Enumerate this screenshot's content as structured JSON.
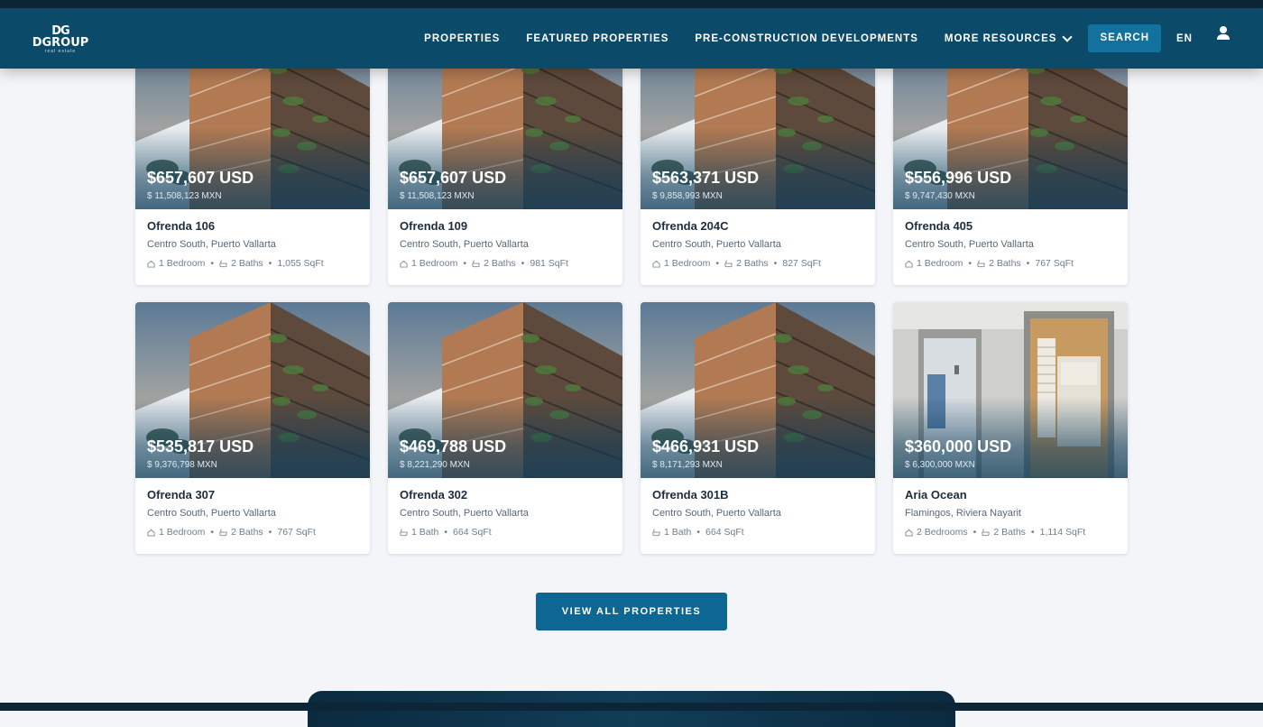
{
  "header": {
    "logo_mark": "DG",
    "logo_word": "DGROUP",
    "logo_sub": "real estate",
    "nav": [
      {
        "label": "PROPERTIES"
      },
      {
        "label": "FEATURED PROPERTIES"
      },
      {
        "label": "PRE-CONSTRUCTION DEVELOPMENTS"
      },
      {
        "label": "MORE RESOURCES"
      }
    ],
    "search_label": "SEARCH",
    "language": "EN"
  },
  "listings": [
    {
      "price_usd": "$657,607 USD",
      "price_mxn": "$ 11,508,123 MXN",
      "name": "Ofrenda 106",
      "location": "Centro South, Puerto Vallarta",
      "bedrooms": "1 Bedroom",
      "baths": "2 Baths",
      "area": "1,055 SqFt",
      "image": "building"
    },
    {
      "price_usd": "$657,607 USD",
      "price_mxn": "$ 11,508,123 MXN",
      "name": "Ofrenda 109",
      "location": "Centro South, Puerto Vallarta",
      "bedrooms": "1 Bedroom",
      "baths": "2 Baths",
      "area": "981 SqFt",
      "image": "building"
    },
    {
      "price_usd": "$563,371 USD",
      "price_mxn": "$ 9,858,993 MXN",
      "name": "Ofrenda 204C",
      "location": "Centro South, Puerto Vallarta",
      "bedrooms": "1 Bedroom",
      "baths": "2 Baths",
      "area": "827 SqFt",
      "image": "building"
    },
    {
      "price_usd": "$556,996 USD",
      "price_mxn": "$ 9,747,430 MXN",
      "name": "Ofrenda 405",
      "location": "Centro South, Puerto Vallarta",
      "bedrooms": "1 Bedroom",
      "baths": "2 Baths",
      "area": "767 SqFt",
      "image": "building"
    },
    {
      "price_usd": "$535,817 USD",
      "price_mxn": "$ 9,376,798 MXN",
      "name": "Ofrenda 307",
      "location": "Centro South, Puerto Vallarta",
      "bedrooms": "1 Bedroom",
      "baths": "2 Baths",
      "area": "767 SqFt",
      "image": "building"
    },
    {
      "price_usd": "$469,788 USD",
      "price_mxn": "$ 8,221,290 MXN",
      "name": "Ofrenda 302",
      "location": "Centro South, Puerto Vallarta",
      "bedrooms": "",
      "baths": "1 Bath",
      "area": "664 SqFt",
      "image": "building"
    },
    {
      "price_usd": "$466,931 USD",
      "price_mxn": "$ 8,171,293 MXN",
      "name": "Ofrenda 301B",
      "location": "Centro South, Puerto Vallarta",
      "bedrooms": "",
      "baths": "1 Bath",
      "area": "664 SqFt",
      "image": "building"
    },
    {
      "price_usd": "$360,000 USD",
      "price_mxn": "$ 6,300,000 MXN",
      "name": "Aria Ocean",
      "location": "Flamingos, Riviera Nayarit",
      "bedrooms": "2 Bedrooms",
      "baths": "2 Baths",
      "area": "1,114 SqFt",
      "image": "interior"
    }
  ],
  "view_all_label": "VIEW ALL PROPERTIES",
  "colors": {
    "navbar": "#0c4a6a",
    "accent": "#0e6693",
    "page_bg": "#f3f5f8"
  },
  "icons": {
    "bedroom": "home-icon",
    "bath": "bathtub-icon",
    "user": "user-icon",
    "dropdown": "chevron-down-icon"
  }
}
